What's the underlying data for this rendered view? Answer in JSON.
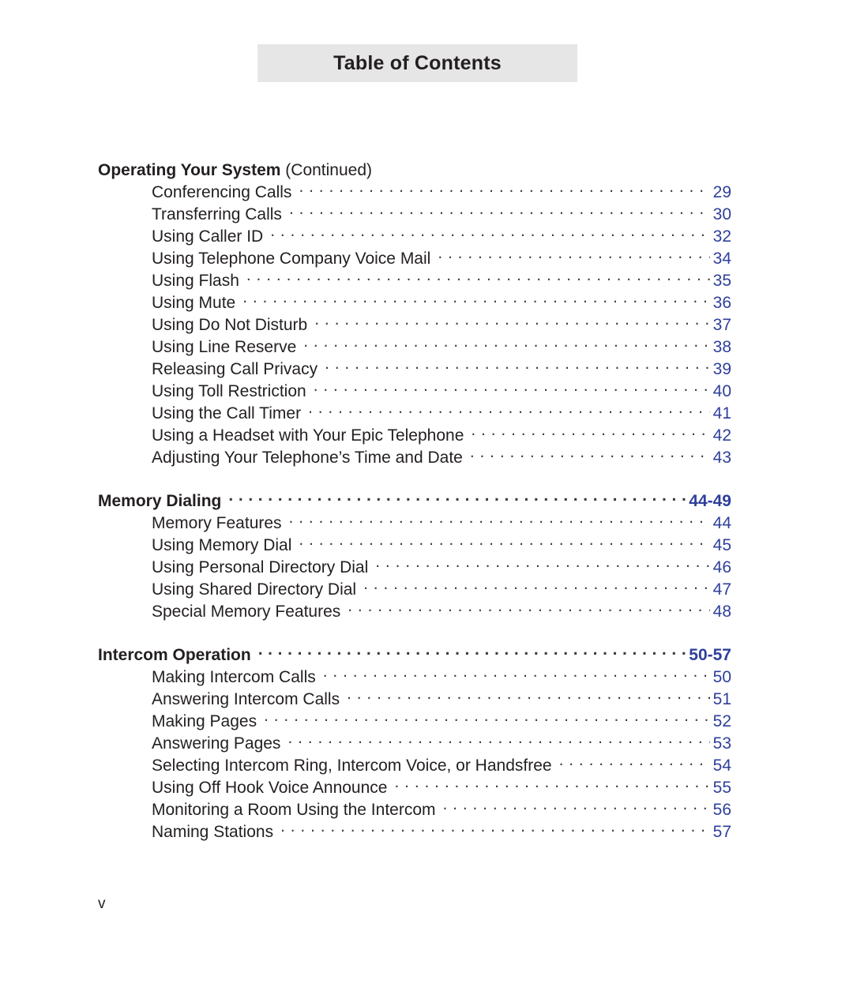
{
  "page": {
    "banner_title": "Table of Contents",
    "folio": "v"
  },
  "sections": [
    {
      "name": "operating-your-system",
      "heading": "Operating Your System",
      "heading_suffix": " (Continued)",
      "has_leader": false,
      "pages": "",
      "entries": [
        {
          "label": "Conferencing Calls",
          "page": "29"
        },
        {
          "label": "Transferring Calls",
          "page": "30"
        },
        {
          "label": "Using Caller ID",
          "page": "32"
        },
        {
          "label": "Using Telephone Company Voice Mail",
          "page": "34"
        },
        {
          "label": "Using Flash",
          "page": "35"
        },
        {
          "label": "Using Mute",
          "page": "36"
        },
        {
          "label": "Using Do Not Disturb",
          "page": "37"
        },
        {
          "label": "Using Line Reserve",
          "page": "38"
        },
        {
          "label": "Releasing Call Privacy",
          "page": "39"
        },
        {
          "label": "Using Toll Restriction",
          "page": "40"
        },
        {
          "label": "Using the Call Timer",
          "page": "41"
        },
        {
          "label": "Using a Headset with Your Epic Telephone",
          "page": "42"
        },
        {
          "label": "Adjusting Your Telephone’s Time and Date",
          "page": "43"
        }
      ]
    },
    {
      "name": "memory-dialing",
      "heading": "Memory Dialing",
      "heading_suffix": "",
      "has_leader": true,
      "pages": "44-49",
      "entries": [
        {
          "label": "Memory Features",
          "page": "44"
        },
        {
          "label": "Using Memory Dial",
          "page": "45"
        },
        {
          "label": "Using Personal Directory Dial",
          "page": "46"
        },
        {
          "label": "Using Shared Directory Dial",
          "page": "47"
        },
        {
          "label": "Special Memory Features",
          "page": "48"
        }
      ]
    },
    {
      "name": "intercom-operation",
      "heading": "Intercom Operation",
      "heading_suffix": "",
      "has_leader": true,
      "pages": "50-57",
      "entries": [
        {
          "label": "Making Intercom Calls",
          "page": "50"
        },
        {
          "label": "Answering Intercom Calls",
          "page": "51"
        },
        {
          "label": "Making Pages",
          "page": "52"
        },
        {
          "label": "Answering Pages",
          "page": "53"
        },
        {
          "label": "Selecting Intercom Ring, Intercom Voice, or Handsfree",
          "page": "54"
        },
        {
          "label": "Using Off Hook Voice Announce",
          "page": "55"
        },
        {
          "label": "Monitoring a Room Using the Intercom",
          "page": "56"
        },
        {
          "label": "Naming Stations",
          "page": "57"
        }
      ]
    }
  ],
  "colors": {
    "banner_bg": "#e6e6e6",
    "text": "#231f20",
    "page_number": "#2e3f9a",
    "leader": "#3c3c3c"
  }
}
